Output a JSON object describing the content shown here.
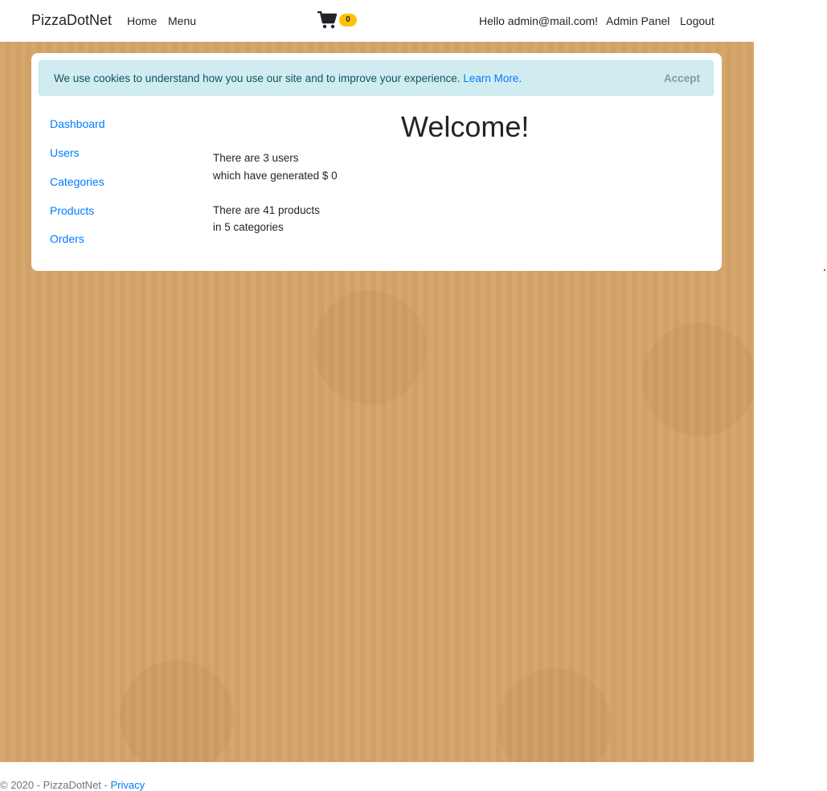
{
  "navbar": {
    "brand": "PizzaDotNet",
    "links": [
      "Home",
      "Menu"
    ],
    "cart_count": "0",
    "greeting": "Hello admin@mail.com!",
    "admin_panel": "Admin Panel",
    "logout": "Logout"
  },
  "cookie_banner": {
    "text": "We use cookies to understand how you use our site and to improve your experience.",
    "link": "Learn More",
    "period": ".",
    "accept": "Accept"
  },
  "sidebar": {
    "items": [
      "Dashboard",
      "Users",
      "Categories",
      "Products",
      "Orders"
    ]
  },
  "main": {
    "title": "Welcome!",
    "users_line1": "There are 3 users",
    "users_line2": "which have generated $ 0",
    "products_line1": "There are 41 products",
    "products_line2": "in 5 categories"
  },
  "footer": {
    "text": "© 2020 - PizzaDotNet - ",
    "privacy": "Privacy"
  },
  "colors": {
    "accent": "#007bff",
    "badge": "#ffc107",
    "background": "#d5a468",
    "cookie_bg": "#d1ecf1"
  }
}
